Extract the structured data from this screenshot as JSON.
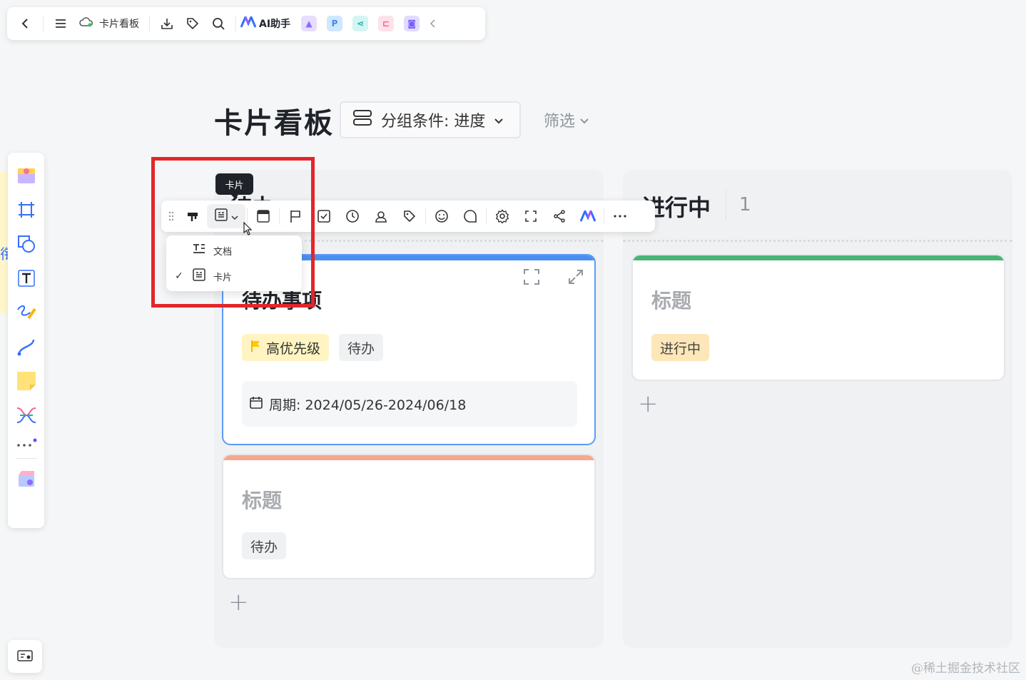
{
  "topbar": {
    "doc_title": "卡片看板",
    "ai_label": "AI助手",
    "icons": [
      "back-icon",
      "menu-icon",
      "cloud-icon",
      "download-icon",
      "tag-icon",
      "search-icon",
      "ai-logo-icon",
      "image-app-icon",
      "p-app-icon",
      "share-app-icon",
      "mindmap-app-icon",
      "chat-app-icon",
      "collapse-icon"
    ],
    "apps": [
      {
        "name": "image-app-icon",
        "color": "#b8a6ff",
        "glyph": "▲"
      },
      {
        "name": "p-app-icon",
        "color": "#3aa0ff",
        "glyph": "P"
      },
      {
        "name": "share-app-icon",
        "color": "#2ec7c9",
        "glyph": "<"
      },
      {
        "name": "mindmap-app-icon",
        "color": "#ff7aa8",
        "glyph": "≺"
      },
      {
        "name": "chat-app-icon",
        "color": "#8a6cff",
        "glyph": "◙"
      }
    ]
  },
  "board": {
    "title": "卡片看板",
    "group_label": "分组条件: 进度",
    "filter_label": "筛选"
  },
  "columns": [
    {
      "title": "待办",
      "cards": [
        {
          "title": "待办事项",
          "bar_color": "#4a8ff0",
          "tags": [
            {
              "text": "高优先级",
              "bg": "#fff4c2"
            },
            {
              "text": "待办",
              "bg": "#f0f1f3"
            }
          ],
          "date_label": "周期: 2024/05/26-2024/06/18"
        },
        {
          "title": "标题",
          "bar_color": "#f7a78e",
          "tags": [
            {
              "text": "待办",
              "bg": "#f0f1f3"
            }
          ]
        }
      ]
    },
    {
      "title": "进行中",
      "count": "1",
      "cards": [
        {
          "title": "标题",
          "bar_color": "#4cb377",
          "tags": [
            {
              "text": "进行中",
              "bg": "#fde6b8"
            }
          ]
        }
      ]
    }
  ],
  "floating_toolbar": {
    "tooltip": "卡片",
    "icons": [
      "drag-handle-icon",
      "style-icon",
      "card-view-icon",
      "chevron-down-icon",
      "cover-icon",
      "flag-icon",
      "checkbox-icon",
      "clock-icon",
      "user-icon",
      "tag-icon",
      "emoji-icon",
      "comment-icon",
      "settings-icon",
      "convert-icon",
      "share-icon",
      "ai-icon",
      "more-icon"
    ]
  },
  "dropdown": {
    "items": [
      {
        "label": "文档",
        "checked": false
      },
      {
        "label": "卡片",
        "checked": true
      }
    ]
  },
  "watermark": "@稀土掘金技术社区",
  "colors": {
    "accent": "#3370ff",
    "highlight": "#e3262a"
  }
}
